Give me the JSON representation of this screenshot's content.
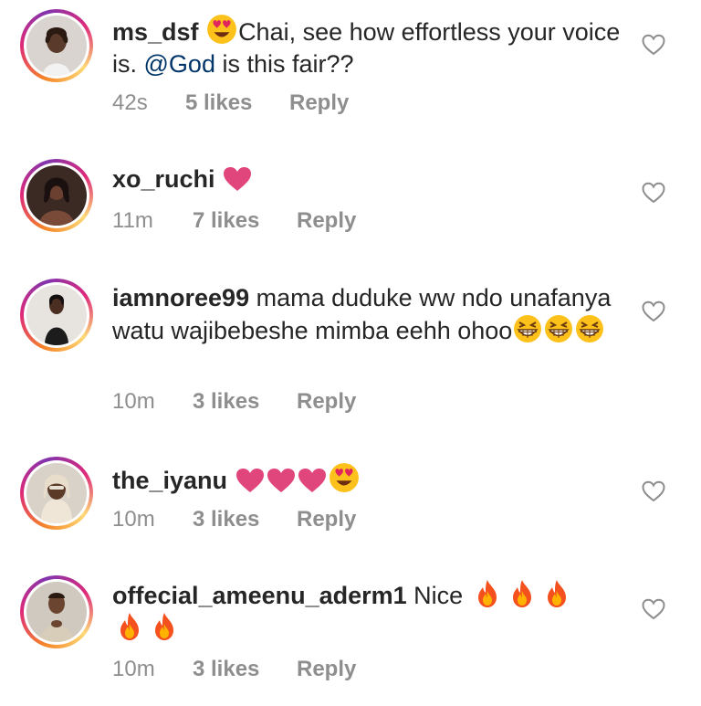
{
  "comments": [
    {
      "username": "ms_dsf",
      "text_before": "Chai, see how effortless your voice is. ",
      "mention": "@God",
      "text_after": " is this fair??",
      "time": "42s",
      "likes": "5 likes",
      "reply": "Reply",
      "emoji_icons": [
        "heart-eyes-emoji-icon"
      ]
    },
    {
      "username": "xo_ruchi",
      "text": "",
      "time": "11m",
      "likes": "7 likes",
      "reply": "Reply",
      "emoji_icons": [
        "pink-heart-emoji-icon"
      ]
    },
    {
      "username": "iamnoree99",
      "text": " mama duduke ww ndo unafanya watu wajibebeshe mimba eehh ohoo",
      "time": "10m",
      "likes": "3 likes",
      "reply": "Reply",
      "emoji_icons": [
        "grinning-squint-emoji-icon",
        "grinning-squint-emoji-icon",
        "grinning-squint-emoji-icon"
      ]
    },
    {
      "username": "the_iyanu",
      "text": "",
      "time": "10m",
      "likes": "3 likes",
      "reply": "Reply",
      "emoji_icons": [
        "pink-heart-emoji-icon",
        "pink-heart-emoji-icon",
        "pink-heart-emoji-icon",
        "heart-eyes-emoji-icon"
      ]
    },
    {
      "username": "offecial_ameenu_aderm1",
      "text": " Nice ",
      "time": "10m",
      "likes": "3 likes",
      "reply": "Reply",
      "emoji_icons": [
        "fire-emoji-icon",
        "fire-emoji-icon",
        "fire-emoji-icon",
        "fire-emoji-icon",
        "fire-emoji-icon"
      ]
    }
  ],
  "colors": {
    "text": "#262626",
    "meta": "#8e8e8e",
    "mention": "#003569",
    "heart_emoji": "#e0457b",
    "like_outline": "#8e8e8e"
  }
}
